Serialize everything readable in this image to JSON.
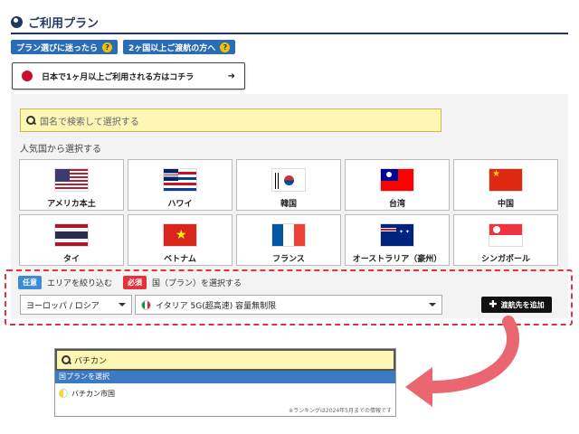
{
  "header": {
    "title": "ご利用プラン"
  },
  "help_links": [
    {
      "label": "プラン選びに迷ったら",
      "icon": "question-icon"
    },
    {
      "label": "2ヶ国以上ご渡航の方へ",
      "icon": "question-icon"
    }
  ],
  "japan_button": {
    "label": "日本で1ヶ月以上ご利用される方はコチラ",
    "arrow": "➜"
  },
  "search": {
    "placeholder": "国名で検索して選択する"
  },
  "popular": {
    "label": "人気国から選択する",
    "countries": [
      {
        "name": "アメリカ本土",
        "flag": "us-flag-icon"
      },
      {
        "name": "ハワイ",
        "flag": "hawaii-flag-icon"
      },
      {
        "name": "韓国",
        "flag": "korea-flag-icon"
      },
      {
        "name": "台湾",
        "flag": "taiwan-flag-icon"
      },
      {
        "name": "中国",
        "flag": "china-flag-icon"
      },
      {
        "name": "タイ",
        "flag": "thailand-flag-icon"
      },
      {
        "name": "ベトナム",
        "flag": "vietnam-flag-icon"
      },
      {
        "name": "フランス",
        "flag": "france-flag-icon"
      },
      {
        "name": "オーストラリア（豪州）",
        "flag": "australia-flag-icon"
      },
      {
        "name": "シンガポール",
        "flag": "singapore-flag-icon"
      }
    ]
  },
  "filter": {
    "optional_tag": "任意",
    "optional_text": "エリアを絞り込む",
    "required_tag": "必須",
    "required_text": "国（プラン）を選択する",
    "region_value": "ヨーロッパ / ロシア",
    "plan_value": "イタリア 5G(超高速) 容量無制限",
    "add_button": "渡航先を追加"
  },
  "dropdown": {
    "input_value": "バチカン",
    "header": "国プランを選択",
    "item": "バチカン市国",
    "note": "※ランキングは2024年5月までの情報です"
  },
  "colors": {
    "navy": "#1f3a5f",
    "accent_blue": "#2a6db5",
    "required_red": "#e0333d",
    "search_yellow": "#fdf6b5",
    "arrow_pink": "#ea6670"
  }
}
